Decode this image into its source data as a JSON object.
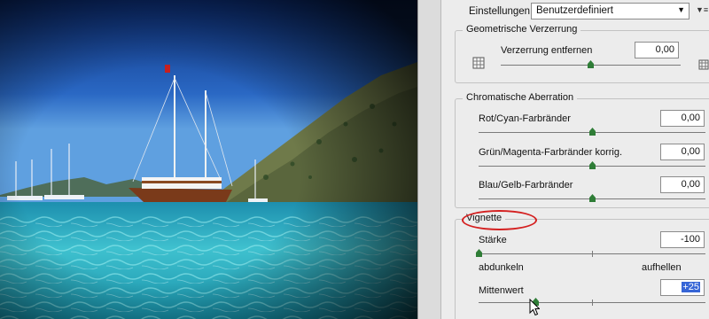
{
  "settings": {
    "label": "Einstellungen:",
    "value": "Benutzerdefiniert"
  },
  "geometric": {
    "title": "Geometrische Verzerrung",
    "remove_label": "Verzerrung entfernen",
    "remove_value": "0,00",
    "remove_level": 0.5
  },
  "chromatic": {
    "title": "Chromatische Aberration",
    "rows": [
      {
        "label": "Rot/Cyan-Farbränder",
        "value": "0,00",
        "level": 0.5
      },
      {
        "label": "Grün/Magenta-Farbränder korrig.",
        "value": "0,00",
        "level": 0.5
      },
      {
        "label": "Blau/Gelb-Farbränder",
        "value": "0,00",
        "level": 0.5
      }
    ]
  },
  "vignette": {
    "title": "Vignette",
    "amount_label": "Stärke",
    "amount_value": "-100",
    "amount_level": 0,
    "left_label": "abdunkeln",
    "right_label": "aufhellen",
    "midpoint_label": "Mittenwert",
    "midpoint_value": "+25",
    "midpoint_level": 0.25
  },
  "icons": {
    "menu": "panel-menu-icon",
    "grid_left": "grid-icon",
    "grid_right": "grid-icon"
  },
  "colors": {
    "highlight": "#d42020",
    "selection": "#3665d6"
  }
}
